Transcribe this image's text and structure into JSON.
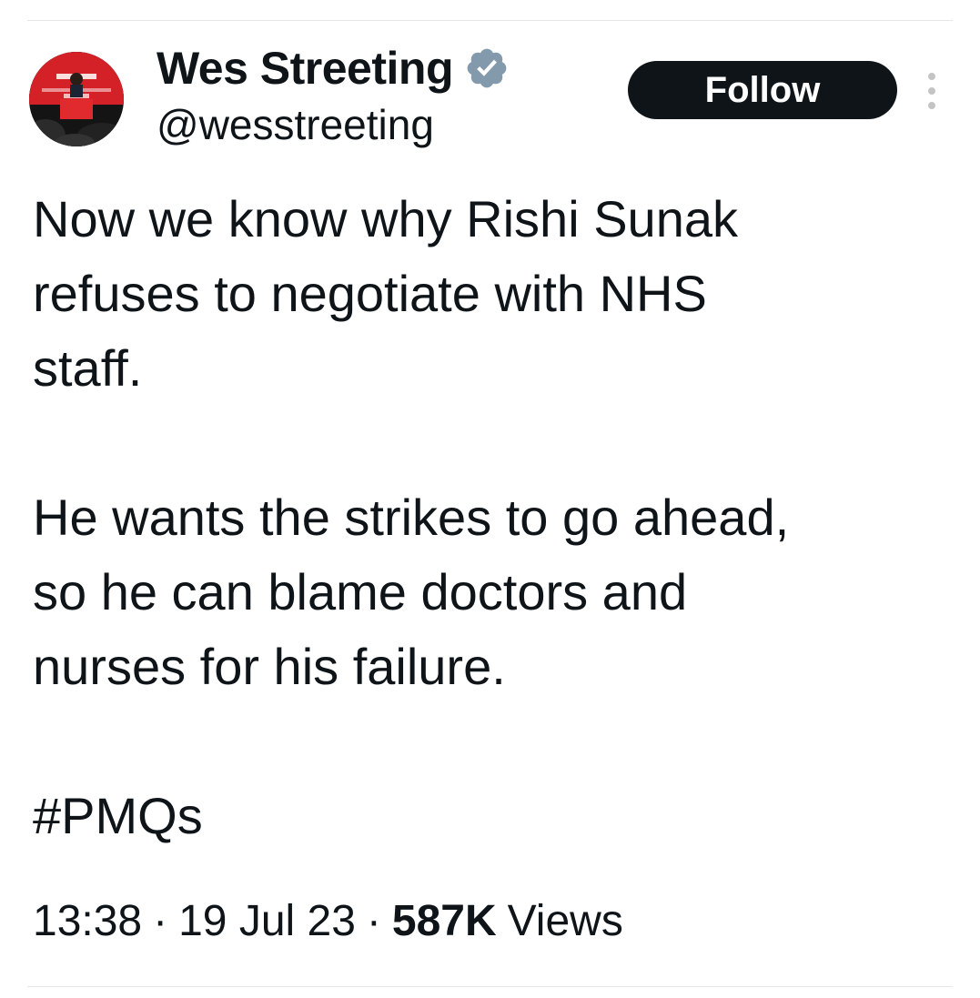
{
  "tweet": {
    "author": {
      "display_name": "Wes Streeting",
      "handle": "@wesstreeting",
      "verified": true,
      "avatar_icon": "profile-photo"
    },
    "follow_label": "Follow",
    "more_icon": "vertical-ellipsis-icon",
    "paragraphs": [
      [
        "Now we know why Rishi Sunak",
        "refuses to negotiate with NHS",
        "staff."
      ],
      [
        "He wants the strikes to go ahead,",
        "so he can blame doctors and",
        "nurses for his failure."
      ]
    ],
    "hashtag": "#PMQs",
    "time": "13:38",
    "date": "19 Jul 23",
    "separator": "·",
    "views_count": "587K",
    "views_label": "Views"
  },
  "colors": {
    "text": "#0f1419",
    "button_bg": "#0f1419",
    "button_text": "#ffffff",
    "verified_badge": "#829aab",
    "divider": "#e6e6e6"
  }
}
